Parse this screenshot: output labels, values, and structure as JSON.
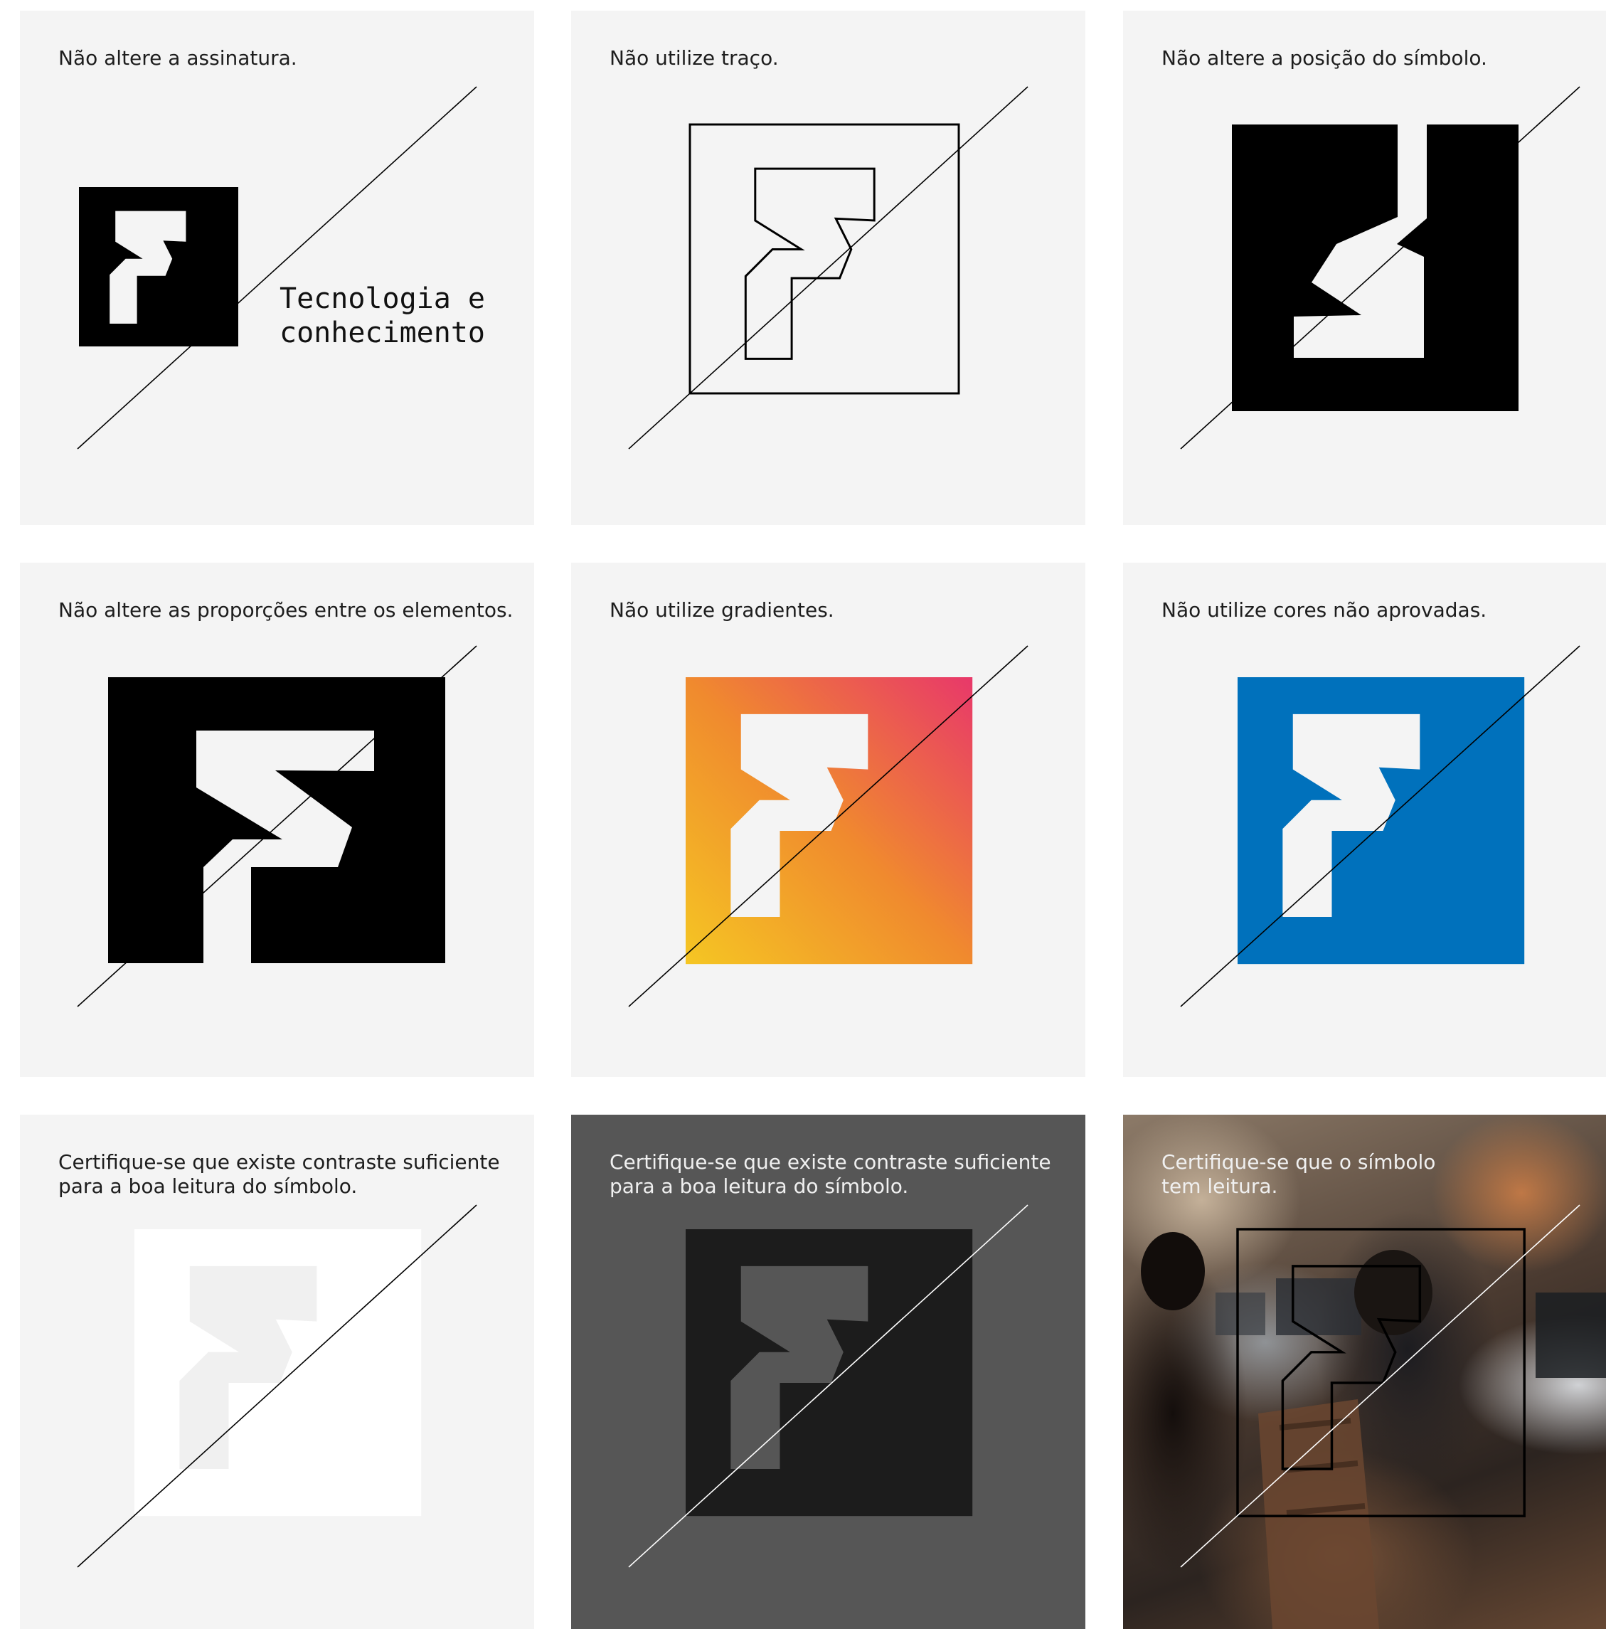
{
  "cards": [
    {
      "caption": "Não altere a assinatura.",
      "tagline_line1": "Tecnologia e",
      "tagline_line2": "conhecimento"
    },
    {
      "caption": "Não utilize traço."
    },
    {
      "caption": "Não altere a posição do símbolo."
    },
    {
      "caption": "Não altere as proporções entre os elementos."
    },
    {
      "caption": "Não utilize gradientes.",
      "gradient_colors": [
        "#f5c623",
        "#f08a2e",
        "#e8386a"
      ]
    },
    {
      "caption": "Não utilize cores não aprovadas.",
      "color": "#0071bc"
    },
    {
      "caption": "Certifique-se que existe contraste suficiente\npara a boa leitura do símbolo."
    },
    {
      "caption": "Certifique-se que existe contraste suficiente\npara a boa leitura do símbolo."
    },
    {
      "caption": "Certifique-se que o símbolo\ntem leitura."
    }
  ],
  "colors": {
    "card_background": "#f4f4f4",
    "dark_card_background": "#565656",
    "symbol_black": "#000000",
    "symbol_dark": "#1c1c1c",
    "symbol_dark_glyph": "#565656"
  }
}
